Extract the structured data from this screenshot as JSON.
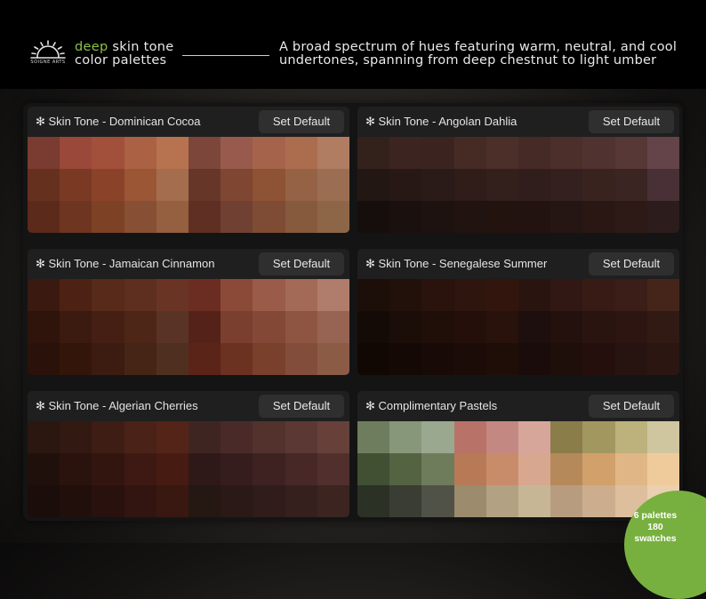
{
  "header": {
    "logo_text": "SOIGNE ARTS",
    "brand_accent": "deep",
    "brand_line1_rest": " skin tone",
    "brand_line2": "color palettes",
    "description_line1": "A broad spectrum of hues featuring warm, neutral, and cool",
    "description_line2": "undertones, spanning from deep chestnut to light umber"
  },
  "accent_color": "#8fc23f",
  "panels": [
    {
      "title": "✻ Skin Tone - Dominican Cocoa",
      "button": "Set Default",
      "swatches": [
        "#7a3b30",
        "#99483a",
        "#a2503c",
        "#ab6244",
        "#b7734f",
        "#7c463b",
        "#995a4e",
        "#a6634c",
        "#ab6d4e",
        "#b07c62",
        "#66301f",
        "#7a3923",
        "#8a4329",
        "#9a5635",
        "#a46e4e",
        "#663629",
        "#7f4731",
        "#8e5234",
        "#966245",
        "#9b6e54",
        "#5b2a1a",
        "#6e3521",
        "#7d4125",
        "#875034",
        "#94603f",
        "#5e2f22",
        "#704133",
        "#7e4c34",
        "#865a3d",
        "#8d6647"
      ]
    },
    {
      "title": "✻ Skin Tone - Angolan Dahlia",
      "button": "Set Default",
      "swatches": [
        "#33211c",
        "#3c2520",
        "#3b2420",
        "#462b24",
        "#4b2f28",
        "#452a26",
        "#4c2f2a",
        "#503230",
        "#573836",
        "#644349",
        "#231714",
        "#271816",
        "#2a1a18",
        "#301c19",
        "#33201c",
        "#301e1c",
        "#34201e",
        "#38231f",
        "#3b2523",
        "#483036",
        "#150e0c",
        "#1a100e",
        "#1e1210",
        "#201310",
        "#22130f",
        "#221310",
        "#251513",
        "#2a1714",
        "#2d1a17",
        "#2d1c1c"
      ]
    },
    {
      "title": "✻ Skin Tone - Jamaican Cinnamon",
      "button": "Set Default",
      "swatches": [
        "#3a1a10",
        "#4d2214",
        "#572a1a",
        "#5e2e1e",
        "#6a3425",
        "#6b2d22",
        "#8a4a37",
        "#9a5b49",
        "#a36a58",
        "#b07c6c",
        "#2e140b",
        "#3b1a10",
        "#461f14",
        "#4d2617",
        "#5a3327",
        "#542219",
        "#7a3f2e",
        "#844836",
        "#8e5543",
        "#976352",
        "#2a1109",
        "#331609",
        "#3c1b10",
        "#472516",
        "#4f2f20",
        "#5b2418",
        "#6b3121",
        "#79402c",
        "#824e3b",
        "#8c5b46"
      ]
    },
    {
      "title": "✻ Skin Tone - Senegalese Summer",
      "button": "Set Default",
      "swatches": [
        "#1c0e08",
        "#22100a",
        "#29130c",
        "#2e150e",
        "#32160e",
        "#2a1410",
        "#311814",
        "#381b15",
        "#3a1e17",
        "#452519",
        "#150b06",
        "#1b0d07",
        "#200f09",
        "#240f0a",
        "#29120b",
        "#1c0f0d",
        "#24110e",
        "#291410",
        "#2d1612",
        "#311a14",
        "#110804",
        "#140905",
        "#180b07",
        "#1c0c07",
        "#1f0e08",
        "#1a0c0a",
        "#1f0f0b",
        "#240f0c",
        "#271310",
        "#2b1611"
      ]
    },
    {
      "title": "✻ Skin Tone - Algerian Cherries",
      "button": "Set Default",
      "swatches": [
        "#2b1610",
        "#321912",
        "#3d1d14",
        "#4a2217",
        "#532417",
        "#3f2522",
        "#4a2a28",
        "#53322e",
        "#5b3834",
        "#664039",
        "#20100b",
        "#2a120d",
        "#331510",
        "#3e1812",
        "#461b12",
        "#2e1918",
        "#361d1d",
        "#3e2222",
        "#472826",
        "#512f2c",
        "#1a0d0a",
        "#210f0b",
        "#29110d",
        "#321410",
        "#381810",
        "#251712",
        "#2a1916",
        "#301c1a",
        "#36201d",
        "#3c2420"
      ]
    },
    {
      "title": "✻ Complimentary Pastels",
      "button": "Set Default",
      "swatches": [
        "#6e7d5e",
        "#86977a",
        "#9aa890",
        "#b97268",
        "#c48882",
        "#d7a69b",
        "#8b7d4a",
        "#a39760",
        "#bdb27c",
        "#cfc6a0",
        "#415033",
        "#546341",
        "#6e7c5c",
        "#b87956",
        "#c98c6a",
        "#d8a790",
        "#b6895a",
        "#d2a06b",
        "#e1b686",
        "#efcb9c",
        "#2c3126",
        "#3a3d33",
        "#505247",
        "#9c8b6c",
        "#b2a283",
        "#c7b696",
        "#b89c7f",
        "#ccae8e",
        "#ddbf9e",
        "#ead0b0"
      ]
    }
  ],
  "badge": {
    "line1": "6 palettes",
    "line2": "180 swatches",
    "color": "#78b03f"
  }
}
